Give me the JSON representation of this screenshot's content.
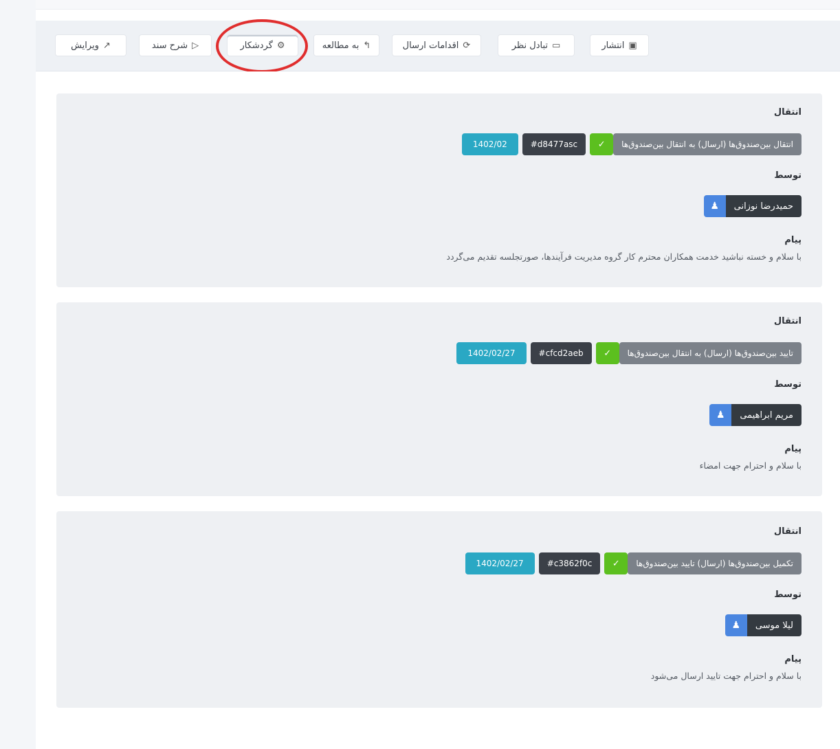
{
  "toolbar": {
    "buttons": [
      {
        "label": "انتشار",
        "icon": "send-icon"
      },
      {
        "label": "تبادل نظر",
        "icon": "comment-icon"
      },
      {
        "label": "اقدامات ارسال",
        "icon": "refresh-icon"
      },
      {
        "label": "به مطالعه",
        "icon": "book-icon"
      },
      {
        "label": "گردشکار",
        "icon": "workflow-icon"
      },
      {
        "label": "شرح سند",
        "icon": "play-icon"
      },
      {
        "label": "ویرایش",
        "icon": "edit-icon"
      }
    ],
    "highlight_color": "#e02e2e"
  },
  "entries": [
    {
      "action_label": "انتقال",
      "path": "انتقال بین‌صندوق‌ها (ارسال) به انتقال بین‌صندوق‌ها",
      "status_icon": "check-icon",
      "hash": "#d8477asc",
      "date": "1402/02",
      "by_label": "توسط",
      "user": "حمیدرضا نوزانی",
      "message_label": "پیام",
      "message": "با سلام و خسته نباشید خدمت همکاران محترم کار گروه مدیریت فرآیندها، صورتجلسه تقدیم می‌گردد"
    },
    {
      "action_label": "انتقال",
      "path": "تایید بین‌صندوق‌ها (ارسال) به انتقال بین‌صندوق‌ها",
      "status_icon": "check-icon",
      "hash": "#cfcd2aeb",
      "date": "1402/02/27",
      "by_label": "توسط",
      "user": "مریم ابراهیمی",
      "message_label": "پیام",
      "message": "با سلام و احترام جهت امضاء"
    },
    {
      "action_label": "انتقال",
      "path": "تکمیل بین‌صندوق‌ها (ارسال) تایید بین‌صندوق‌ها",
      "status_icon": "check-icon",
      "hash": "#c3862f0c",
      "date": "1402/02/27",
      "by_label": "توسط",
      "user": "لیلا موسی",
      "message_label": "پیام",
      "message": "با سلام و احترام جهت تایید ارسال می‌شود"
    }
  ],
  "colors": {
    "path_badge": "#7b8189",
    "ok_badge": "#5cbf1f",
    "hash_badge": "#3b4048",
    "date_badge": "#2aa8c4",
    "user_badge": "#343a40",
    "user_icon": "#4a86e0",
    "card_bg": "#eef0f3"
  }
}
